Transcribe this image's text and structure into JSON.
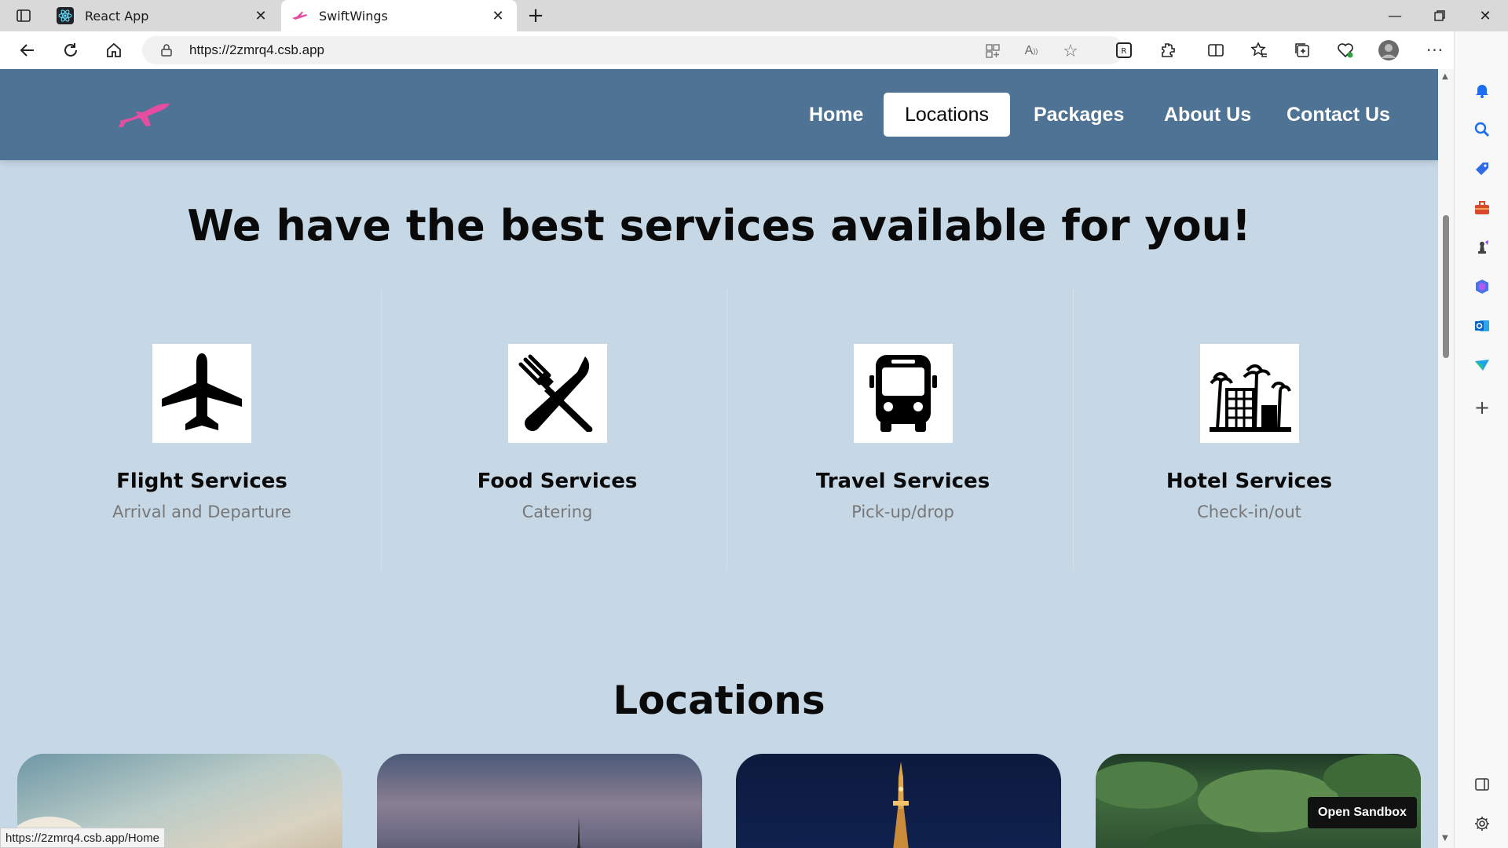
{
  "browser": {
    "tabs": [
      {
        "title": "React App",
        "active": false
      },
      {
        "title": "SwiftWings",
        "active": true
      }
    ],
    "url": "https://2zmrq4.csb.app",
    "status_url": "https://2zmrq4.csb.app/Home"
  },
  "site": {
    "nav": [
      {
        "label": "Home",
        "active": false
      },
      {
        "label": "Locations",
        "active": true
      },
      {
        "label": "Packages",
        "active": false
      },
      {
        "label": "About Us",
        "active": false
      },
      {
        "label": "Contact Us",
        "active": false
      }
    ],
    "services_heading": "We have the best services available for you!",
    "services": [
      {
        "title": "Flight Services",
        "subtitle": "Arrival and Departure",
        "icon": "airplane-icon"
      },
      {
        "title": "Food Services",
        "subtitle": "Catering",
        "icon": "fork-knife-icon"
      },
      {
        "title": "Travel Services",
        "subtitle": "Pick-up/drop",
        "icon": "bus-icon"
      },
      {
        "title": "Hotel Services",
        "subtitle": "Check-in/out",
        "icon": "hotel-palm-icon"
      }
    ],
    "locations_heading": "Locations",
    "open_sandbox_label": "Open Sandbox"
  },
  "colors": {
    "header": "#4f7394",
    "page_background": "#c6d7e5",
    "logo_pink": "#e64da0",
    "tab_strip": "#d9d9d9"
  }
}
